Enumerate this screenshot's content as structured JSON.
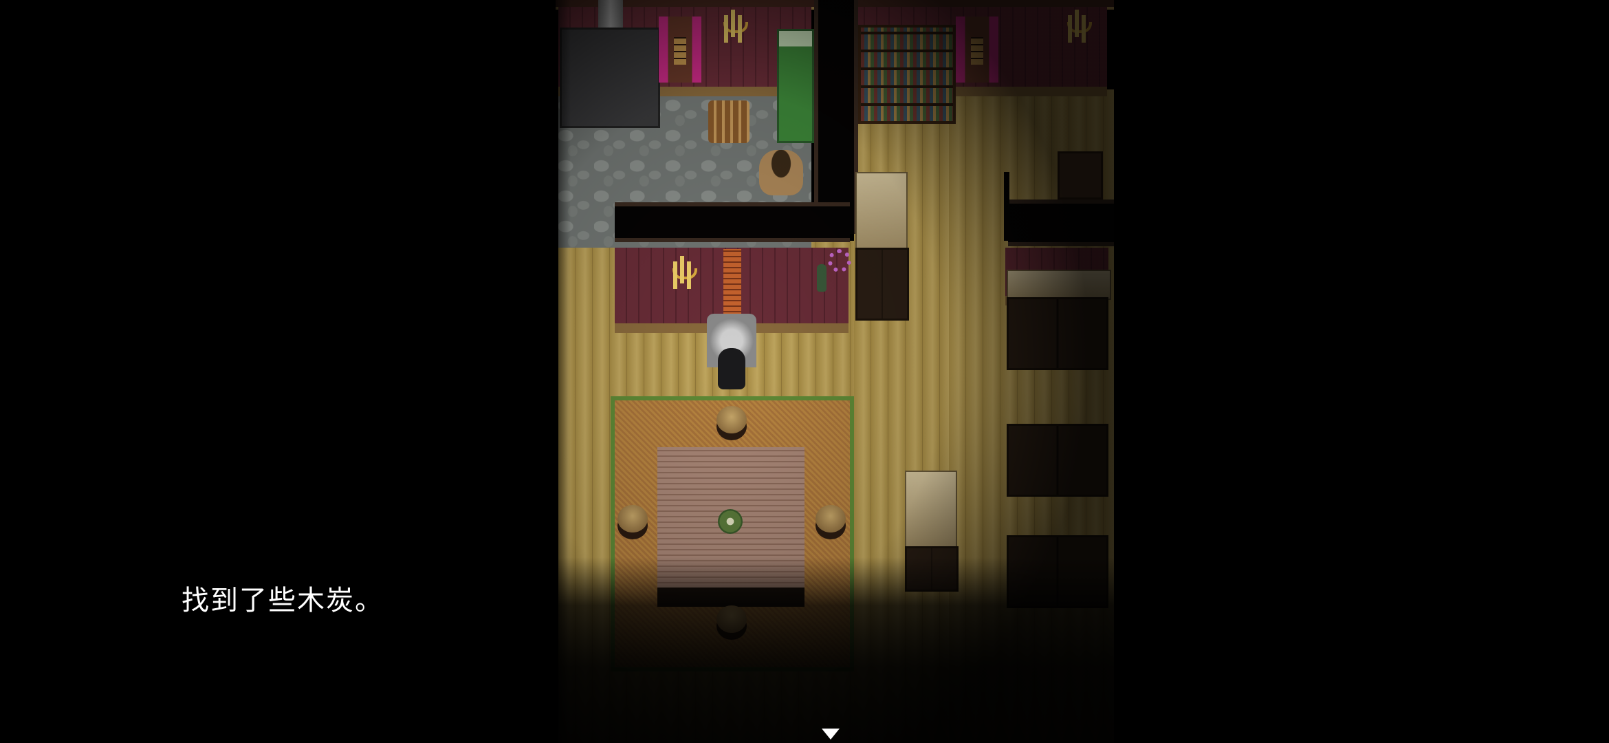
{
  "message": {
    "text": "找到了些木炭。",
    "continue_indicator": "triangle-down-icon"
  },
  "colors": {
    "text": "#ffffff",
    "background": "#000000",
    "wall": "#5c2530",
    "floor": "#b59a52",
    "curtain": "#d42c8c",
    "carpet_border": "#5f8a36"
  }
}
